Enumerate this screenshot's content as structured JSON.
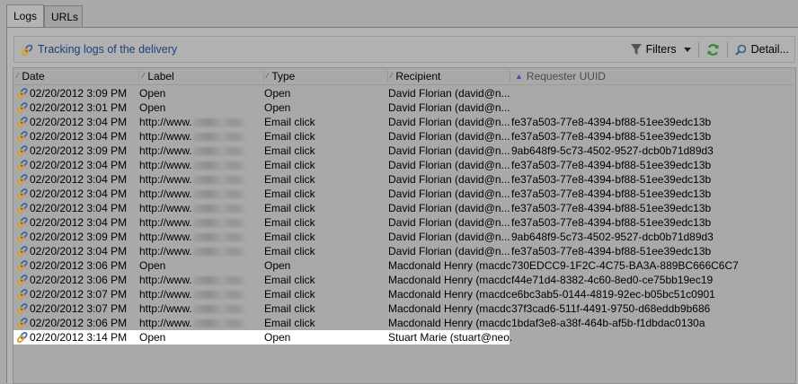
{
  "tabs": [
    {
      "label": "Logs",
      "active": true
    },
    {
      "label": "URLs",
      "active": false
    }
  ],
  "toolbar": {
    "title": "Tracking logs of the delivery",
    "filters_label": "Filters",
    "detail_label": "Detail..."
  },
  "columns": {
    "date": "Date",
    "label": "Label",
    "type": "Type",
    "recipient": "Recipient",
    "uuid": "Requester UUID"
  },
  "rows": [
    {
      "date": "02/20/2012 3:09 PM",
      "label": "Open",
      "type": "Open",
      "recipient": "David Florian (david@n...",
      "uuid": ""
    },
    {
      "date": "02/20/2012 3:01 PM",
      "label": "Open",
      "type": "Open",
      "recipient": "David Florian (david@n...",
      "uuid": ""
    },
    {
      "date": "02/20/2012 3:04 PM",
      "label": "http://www.",
      "type": "Email click",
      "recipient": "David Florian (david@n...",
      "uuid": "fe37a503-77e8-4394-bf88-51ee39edc13b"
    },
    {
      "date": "02/20/2012 3:04 PM",
      "label": "http://www.",
      "type": "Email click",
      "recipient": "David Florian (david@n...",
      "uuid": "fe37a503-77e8-4394-bf88-51ee39edc13b"
    },
    {
      "date": "02/20/2012 3:09 PM",
      "label": "http://www.",
      "type": "Email click",
      "recipient": "David Florian (david@n...",
      "uuid": "9ab648f9-5c73-4502-9527-dcb0b71d89d3"
    },
    {
      "date": "02/20/2012 3:04 PM",
      "label": "http://www.",
      "type": "Email click",
      "recipient": "David Florian (david@n...",
      "uuid": "fe37a503-77e8-4394-bf88-51ee39edc13b"
    },
    {
      "date": "02/20/2012 3:04 PM",
      "label": "http://www.",
      "type": "Email click",
      "recipient": "David Florian (david@n...",
      "uuid": "fe37a503-77e8-4394-bf88-51ee39edc13b"
    },
    {
      "date": "02/20/2012 3:04 PM",
      "label": "http://www.",
      "type": "Email click",
      "recipient": "David Florian (david@n...",
      "uuid": "fe37a503-77e8-4394-bf88-51ee39edc13b"
    },
    {
      "date": "02/20/2012 3:04 PM",
      "label": "http://www.",
      "type": "Email click",
      "recipient": "David Florian (david@n...",
      "uuid": "fe37a503-77e8-4394-bf88-51ee39edc13b"
    },
    {
      "date": "02/20/2012 3:04 PM",
      "label": "http://www.",
      "type": "Email click",
      "recipient": "David Florian (david@n...",
      "uuid": "fe37a503-77e8-4394-bf88-51ee39edc13b"
    },
    {
      "date": "02/20/2012 3:09 PM",
      "label": "http://www.",
      "type": "Email click",
      "recipient": "David Florian (david@n...",
      "uuid": "9ab648f9-5c73-4502-9527-dcb0b71d89d3"
    },
    {
      "date": "02/20/2012 3:04 PM",
      "label": "http://www.",
      "type": "Email click",
      "recipient": "David Florian (david@n...",
      "uuid": "fe37a503-77e8-4394-bf88-51ee39edc13b"
    },
    {
      "date": "02/20/2012 3:06 PM",
      "label": "Open",
      "type": "Open",
      "recipient": "Macdonald Henry (macdc",
      "uuid": "730EDCC9-1F2C-4C75-BA3A-889BC666C6C7"
    },
    {
      "date": "02/20/2012 3:06 PM",
      "label": "http://www.",
      "type": "Email click",
      "recipient": "Macdonald Henry (macdc",
      "uuid": "f44e71d4-8382-4c60-8ed0-ce75bb19ec19"
    },
    {
      "date": "02/20/2012 3:07 PM",
      "label": "http://www.",
      "type": "Email click",
      "recipient": "Macdonald Henry (macdc",
      "uuid": "e6bc3ab5-0144-4819-92ec-b05bc51c0901"
    },
    {
      "date": "02/20/2012 3:07 PM",
      "label": "http://www.",
      "type": "Email click",
      "recipient": "Macdonald Henry (macdc",
      "uuid": "37f3cad6-511f-4491-9750-d68eddb9b686"
    },
    {
      "date": "02/20/2012 3:06 PM",
      "label": "http://www.",
      "type": "Email click",
      "recipient": "Macdonald Henry (macdc",
      "uuid": "1bdaf3e8-a38f-464b-af5b-f1dbdac0130a"
    },
    {
      "date": "02/20/2012 3:14 PM",
      "label": "Open",
      "type": "Open",
      "recipient": "Stuart Marie (stuart@neo.",
      "uuid": "",
      "selected": true
    }
  ]
}
